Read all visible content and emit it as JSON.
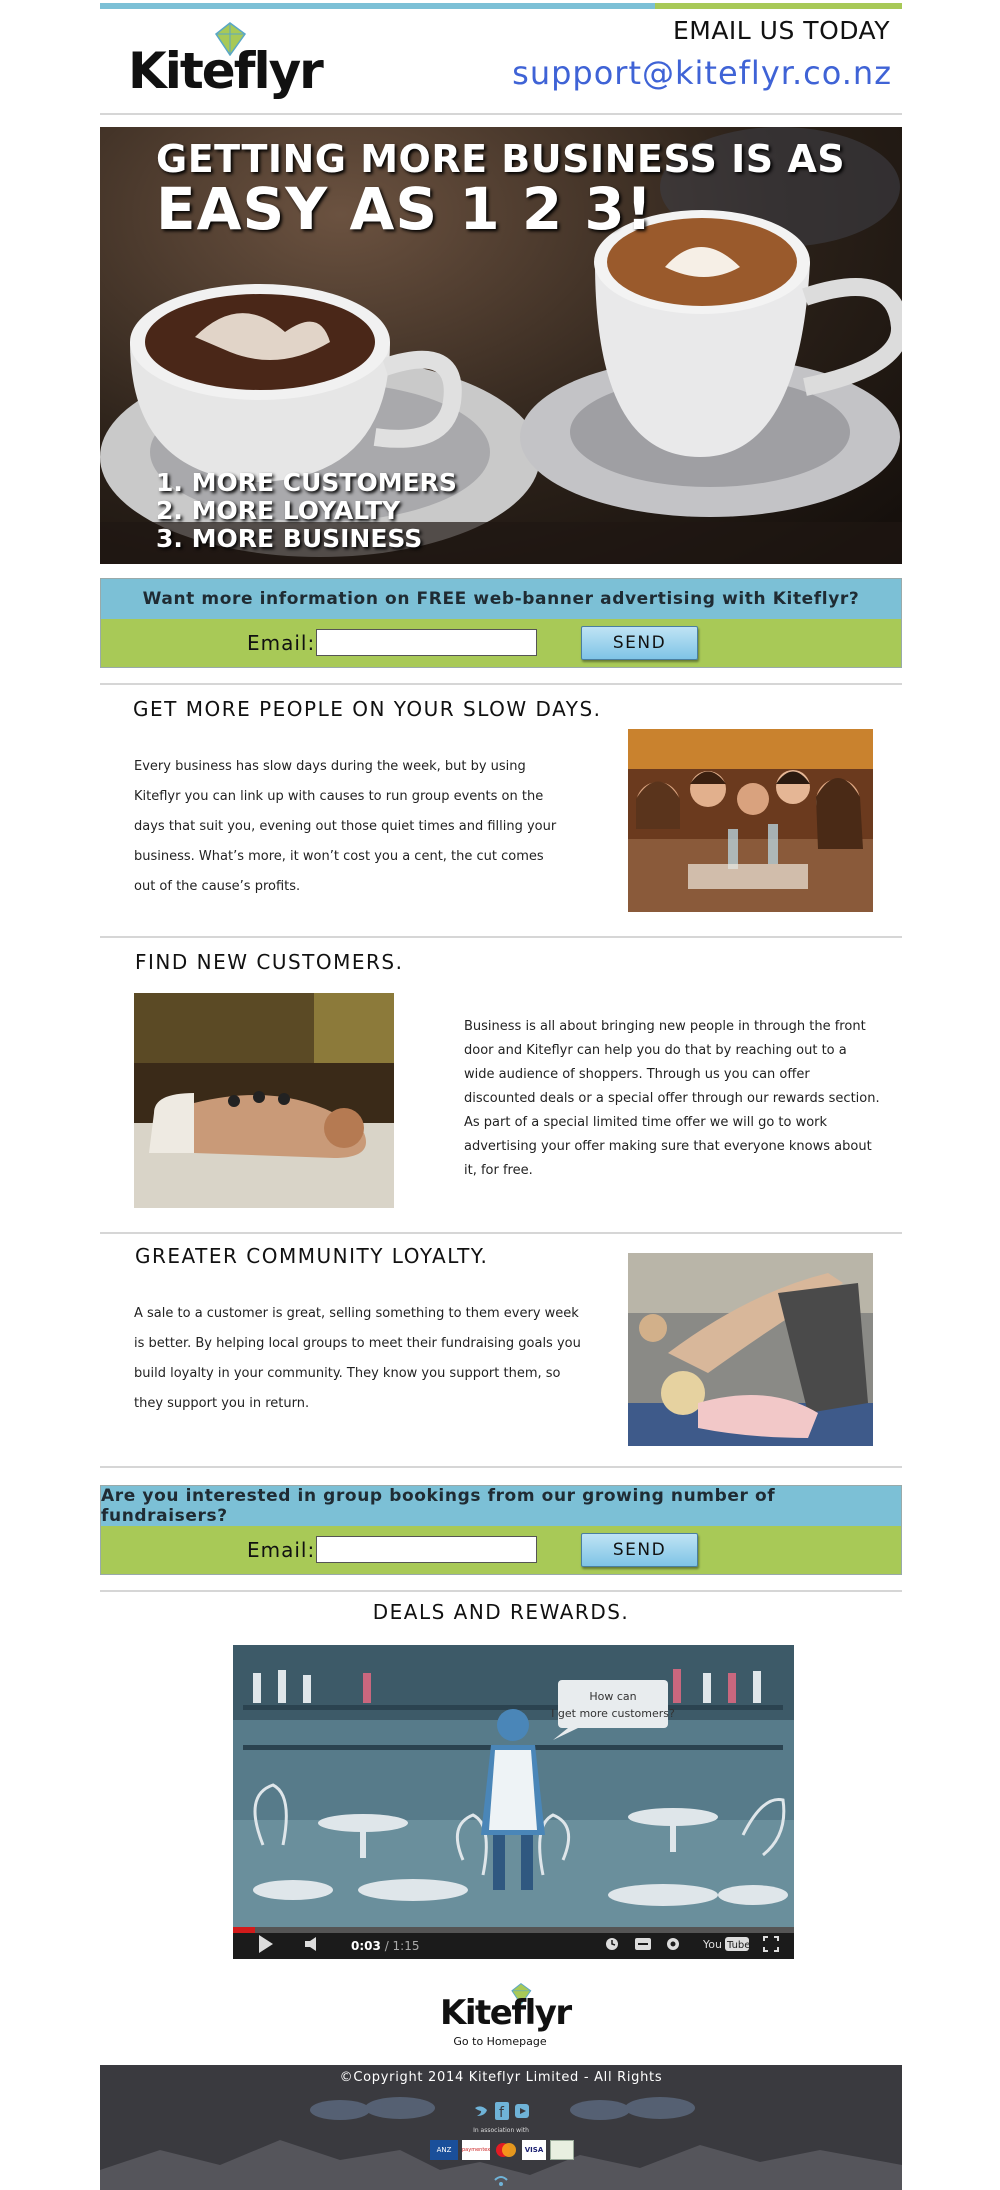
{
  "header": {
    "email_title": "EMAIL US TODAY",
    "email_address": "support@kiteflyr.co.nz",
    "logo_text": "Kiteflyr"
  },
  "hero": {
    "line1": "GETTING MORE BUSINESS IS AS",
    "line2": "EASY AS  1  2  3!",
    "list": [
      "1.  MORE CUSTOMERS",
      "2.  MORE LOYALTY",
      "3.  MORE BUSINESS"
    ]
  },
  "signup1": {
    "question": "Want more information on FREE web-banner advertising with Kiteflyr?",
    "email_label": "Email:",
    "button": "SEND"
  },
  "section1": {
    "title": "GET MORE PEOPLE ON YOUR SLOW DAYS.",
    "lines": [
      "Every business has slow days during the week, but by using",
      "Kiteflyr you can link up with causes to run group events on the",
      "days that suit you, evening out those quiet times and filling your",
      "business. What’s more, it won’t cost you a cent, the cut comes",
      "out of the cause’s profits."
    ]
  },
  "section2": {
    "title": "FIND NEW CUSTOMERS.",
    "lines": [
      "Business is all about bringing new people in through the front",
      "door and Kiteflyr can help you do that by reaching out to a",
      "wide audience of shoppers. Through us you can offer",
      "discounted deals or a special offer through our rewards section.",
      "As part of a special limited time offer we will go to work",
      "advertising your offer making sure that everyone knows about",
      "it, for free."
    ]
  },
  "section3": {
    "title": "GREATER COMMUNITY LOYALTY.",
    "lines": [
      "A sale to a customer is great, selling something to them every week",
      "is better. By helping local groups to meet their fundraising goals you",
      "build loyalty in your community. They know you support them, so",
      "they support you in return."
    ]
  },
  "signup2": {
    "question": "Are you interested in group bookings from our growing number of fundraisers?",
    "email_label": "Email:",
    "button": "SEND"
  },
  "deals": {
    "title": "DEALS AND REWARDS.",
    "video": {
      "speech_line1": "How can",
      "speech_line2": "I get more customers?",
      "current_time": "0:03",
      "total_time": "/ 1:15",
      "progress": 0.04
    }
  },
  "footer": {
    "logo_text": "Kiteflyr",
    "home_link": "Go to Homepage",
    "copyright": "©Copyright 2014 Kiteflyr Limited - All Rights",
    "association": "In association with",
    "partners": [
      "ANZ",
      "paymentexpress",
      "MasterCard",
      "VISA",
      ""
    ]
  },
  "colors": {
    "accent_blue": "#7cc0d6",
    "accent_green": "#a8c957",
    "link_blue": "#3f63d6",
    "footer_bg": "#3a3a3f"
  }
}
